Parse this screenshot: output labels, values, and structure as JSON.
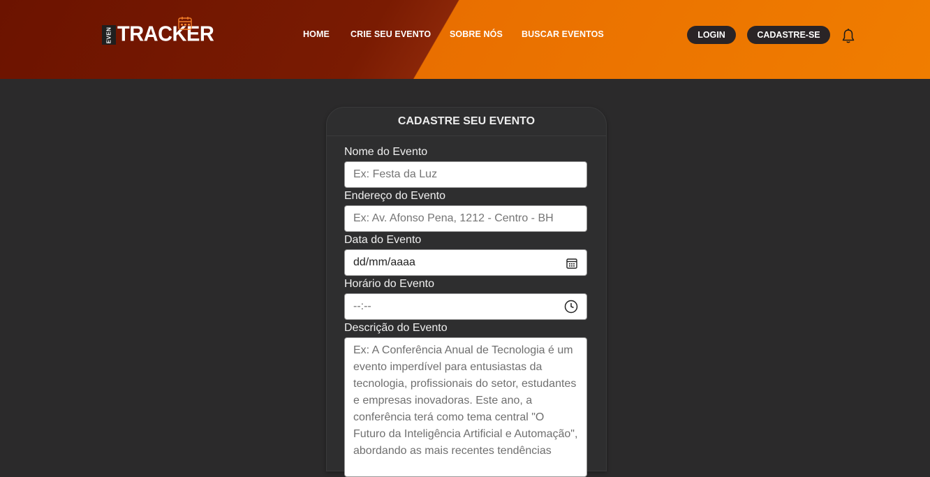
{
  "brand": {
    "prefix": "EVEN",
    "name": "TRACKER"
  },
  "nav": [
    {
      "label": "HOME"
    },
    {
      "label": "CRIE SEU EVENTO"
    },
    {
      "label": "SOBRE NÓS"
    },
    {
      "label": "BUSCAR EVENTOS"
    }
  ],
  "auth": {
    "login": "LOGIN",
    "signup": "CADASTRE-SE"
  },
  "icons": {
    "bell": "bell-icon",
    "calendar": "calendar-icon",
    "clock": "clock-icon"
  },
  "colors": {
    "header_dark": "#6c1300",
    "header_orange": "#f07d00",
    "pill": "#2a2426",
    "background": "#2b2a2b"
  },
  "form": {
    "title": "CADASTRE SEU EVENTO",
    "name": {
      "label": "Nome do Evento",
      "placeholder": "Ex: Festa da Luz"
    },
    "address": {
      "label": "Endereço do Evento",
      "placeholder": "Ex: Av. Afonso Pena, 1212 - Centro - BH"
    },
    "date": {
      "label": "Data do Evento",
      "value": "dd/mm/aaaa"
    },
    "time": {
      "label": "Horário do Evento",
      "value": "--:--"
    },
    "description": {
      "label": "Descrição do Evento",
      "placeholder": "Ex: A Conferência Anual de Tecnologia é um evento imperdível para entusiastas da tecnologia, profissionais do setor, estudantes e empresas inovadoras. Este ano, a conferência terá como tema central \"O Futuro da Inteligência Artificial e Automação\", abordando as mais recentes tendências"
    }
  }
}
